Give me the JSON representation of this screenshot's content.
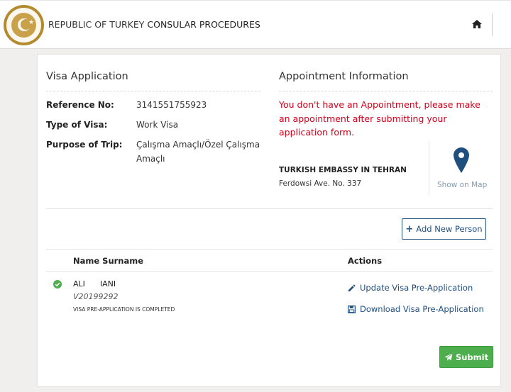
{
  "header": {
    "title_prefix": "REPUBLIC OF TURKEY",
    "title_rest": " CONSULAR PROCEDURES"
  },
  "visa": {
    "title": "Visa Application",
    "fields": [
      {
        "label": "Reference No:",
        "value": "3141551755923"
      },
      {
        "label": "Type of Visa:",
        "value": "Work Visa"
      },
      {
        "label": "Purpose of Trip:",
        "value": "Çalışma Amaçlı/Özel Çalışma Amaçlı"
      }
    ]
  },
  "appointment": {
    "title": "Appointment Information",
    "warning": "You don't have an Appointment, please make an appointment after submitting your application form.",
    "embassy_name": "TURKISH EMBASSY IN TEHRAN",
    "embassy_address": "Ferdowsi Ave. No. 337",
    "map_label": "Show on Map"
  },
  "add_person_label": "Add New Person",
  "table": {
    "col_name": "Name Surname",
    "col_actions": "Actions",
    "rows": [
      {
        "name": "ALI      IANI",
        "id": "V20199292",
        "status": "VISA PRE-APPLICATION IS COMPLETED",
        "update_label": "Update Visa Pre-Application",
        "download_label": "Download Visa Pre-Application"
      }
    ]
  },
  "submit_label": "Submit",
  "colors": {
    "accent": "#1f4f7f",
    "warning": "#d0021b",
    "success": "#4cae4c",
    "gold": "#b38a2e"
  },
  "icons": {
    "home": "home-icon",
    "map": "map-pin-icon",
    "check": "check-circle-icon",
    "edit": "pencil-icon",
    "download": "save-icon",
    "submit": "paper-plane-icon",
    "add": "plus-icon"
  }
}
